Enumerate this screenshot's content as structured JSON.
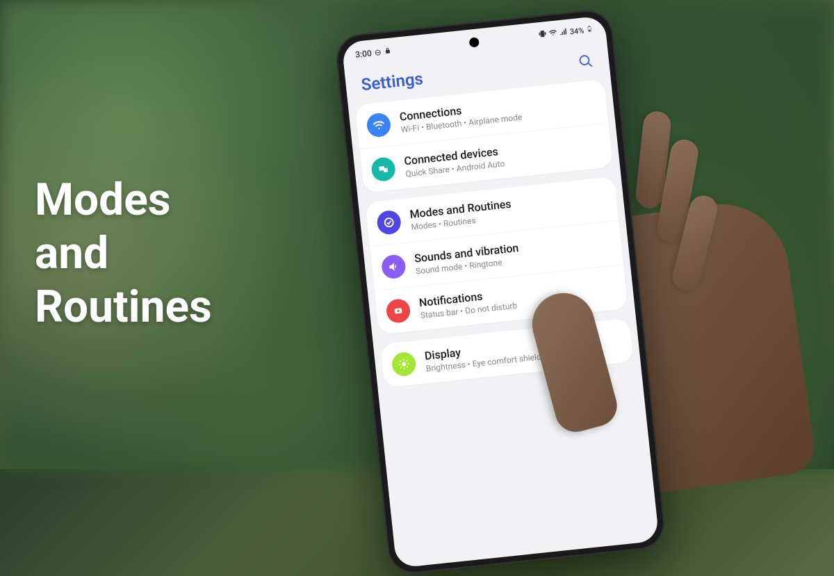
{
  "overlay_title": "Modes\nand\nRoutines",
  "status_bar": {
    "time": "3:00",
    "battery": "34%"
  },
  "header": {
    "title": "Settings"
  },
  "groups": [
    {
      "items": [
        {
          "title": "Connections",
          "subtitle": "Wi-Fi • Bluetooth • Airplane mode"
        },
        {
          "title": "Connected devices",
          "subtitle": "Quick Share • Android Auto"
        }
      ]
    },
    {
      "items": [
        {
          "title": "Modes and Routines",
          "subtitle": "Modes • Routines"
        },
        {
          "title": "Sounds and vibration",
          "subtitle": "Sound mode • Ringtone"
        },
        {
          "title": "Notifications",
          "subtitle": "Status bar • Do not disturb"
        }
      ]
    },
    {
      "items": [
        {
          "title": "Display",
          "subtitle": "Brightness • Eye comfort shield • Navigation bar"
        }
      ]
    }
  ]
}
